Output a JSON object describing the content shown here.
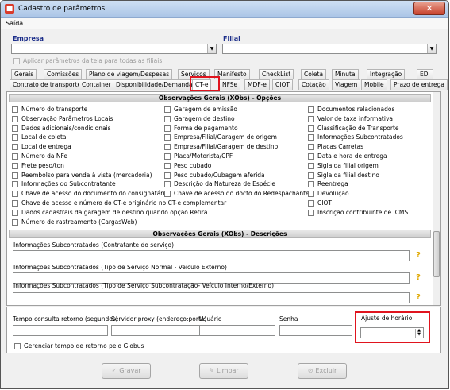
{
  "window": {
    "title": "Cadastro de parâmetros",
    "close_icon": "close-icon",
    "app_icon": "app-icon"
  },
  "menu": {
    "saida": "Saída"
  },
  "empresa": {
    "label": "Empresa",
    "value": ""
  },
  "filial": {
    "label": "Filial",
    "value": ""
  },
  "aplicar": {
    "label": "Aplicar parâmetros da tela para todas as filiais"
  },
  "tabs_row1": [
    "Gerais",
    "Comissões",
    "Plano de viagem/Despesas",
    "Serviços",
    "Manifesto",
    "CheckList",
    "Coleta",
    "Minuta",
    "Integração",
    "EDI"
  ],
  "tabs_row2": [
    "Contrato de transporte",
    "Container",
    "Disponibilidade/Demanda",
    "CT-e",
    "NFSe",
    "MDF-e",
    "CIOT",
    "Cotação",
    "Viagem",
    "Mobile",
    "Prazo de entrega"
  ],
  "active_tab": "CT-e",
  "section_opcoes": "Observações Gerais (XObs) - Opções",
  "options_col1": [
    "Número do transporte",
    "Observação Parâmetros Locais",
    "Dados adicionais/condicionais",
    "Local de coleta",
    "Local de entrega",
    "Número da NFe",
    "Frete peso/ton",
    "Reembolso para venda à vista (mercadoria)",
    "Informações do Subcontratante",
    "Chave de acesso do documento do consignatário",
    "Chave de acesso e número do CT-e originário no CT-e complementar",
    "Dados cadastrais da garagem de destino quando opção Retira",
    "Número de rastreamento (CargasWeb)"
  ],
  "options_col2": [
    "Garagem de emissão",
    "Garagem de destino",
    "Forma de pagamento",
    "Empresa/Filial/Garagem de origem",
    "Empresa/Filial/Garagem de destino",
    "Placa/Motorista/CPF",
    "Peso cubado",
    "Peso cubado/Cubagem aferida",
    "Descrição da Natureza de Espécie",
    "Chave de acesso do docto do Redespachante"
  ],
  "options_col3": [
    "Documentos relacionados",
    "Valor de taxa informativa",
    "Classificação de Transporte",
    "Informações Subcontratados",
    "Placas Carretas",
    "Data e hora de entrega",
    "Sigla da filial origem",
    "Sigla da filial destino",
    "Reentrega",
    "Devolução",
    "CIOT",
    "Inscrição contribuinte de ICMS"
  ],
  "section_descricoes": "Observações Gerais (XObs) - Descrições",
  "desc_fields": [
    "Informações Subcontratados (Contratante do serviço)",
    "Informações Subcontratados (Tipo de Serviço Normal - Veículo Externo)",
    "Informações Subcontratados (Tipo de Serviço Subcontratação- Veículo Interno/Externo)"
  ],
  "help_icon": "help-icon",
  "bottom": {
    "tempo_label": "Tempo consulta retorno (segundos)",
    "proxy_label": "Servidor proxy (endereço:porta)",
    "usuario_label": "Usuário",
    "senha_label": "Senha",
    "ajuste_label": "Ajuste de horário",
    "ajuste_value": "",
    "gerenciar_label": "Gerenciar tempo de retorno pelo Globus"
  },
  "buttons": {
    "gravar": "Gravar",
    "limpar": "Limpar",
    "excluir": "Excluir"
  },
  "colors": {
    "highlight": "#e0141e",
    "label_blue": "#1c2e8a",
    "help_yellow": "#e0a800"
  }
}
